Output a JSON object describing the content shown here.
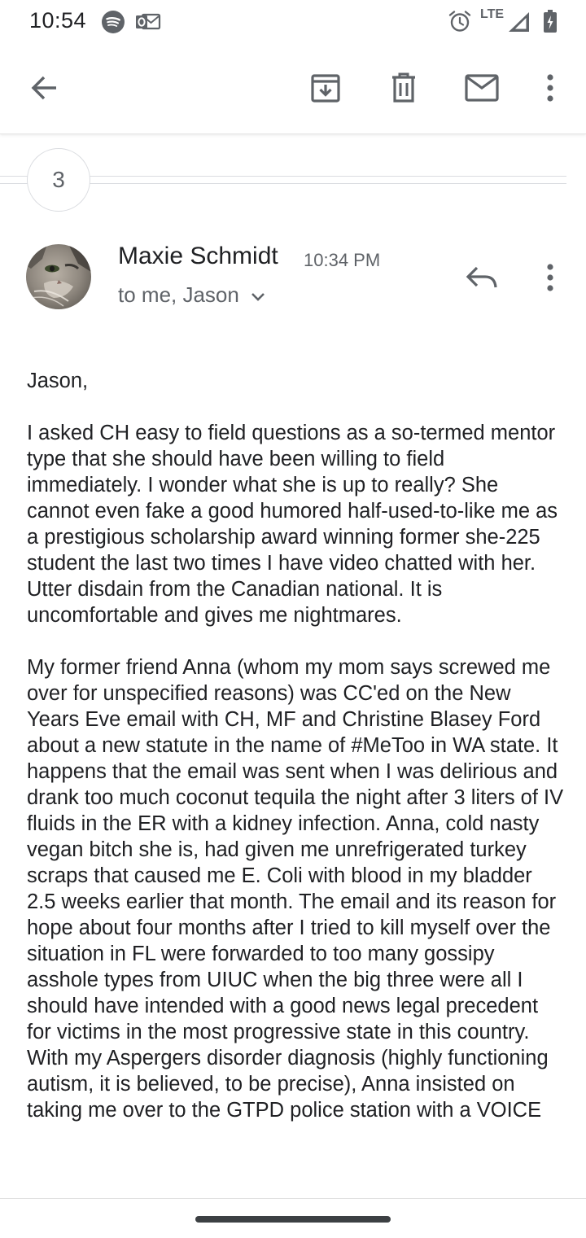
{
  "status_bar": {
    "time": "10:54",
    "network": "LTE",
    "icons": [
      "spotify-icon",
      "outlook-icon",
      "alarm-icon",
      "signal-icon",
      "battery-icon"
    ]
  },
  "app_bar": {
    "icons": [
      "back-arrow-icon",
      "archive-icon",
      "delete-icon",
      "mark-unread-icon",
      "more-vert-icon"
    ]
  },
  "thread": {
    "collapsed_count": "3"
  },
  "message": {
    "sender": "Maxie Schmidt",
    "time": "10:34 PM",
    "recipients": "to me, Jason",
    "body": [
      "Jason,",
      "I asked CH easy to field questions as a so-termed mentor type that she should have been willing to field immediately. I wonder what she is up to really? She cannot even fake a good humored half-used-to-like me as a prestigious scholarship award winning former she-225 student the last two times I have video chatted with her. Utter disdain from the Canadian national. It is uncomfortable and gives me nightmares.",
      "My former friend Anna (whom my mom says screwed me over for unspecified reasons) was CC'ed on the New Years Eve email with CH, MF and Christine Blasey Ford about a new statute in the name of #MeToo in WA state. It happens that the email was sent when I was delirious and drank too much coconut tequila the night after 3 liters of IV fluids in the ER with a kidney infection. Anna, cold nasty vegan bitch she is, had given me unrefrigerated turkey scraps that caused me E. Coli with blood in my bladder 2.5 weeks earlier that month. The email and its reason for hope about four months after I tried to kill myself over the situation in FL were forwarded to too many gossipy asshole types from UIUC when the big three were all I should have intended with a good news legal precedent for victims in the most progressive state in this country. With my Aspergers disorder diagnosis (highly functioning autism, it is believed, to be precise), Anna insisted on taking me over to the GTPD police station with a VOICE"
    ]
  },
  "colors": {
    "text_primary": "#202124",
    "text_secondary": "#5f6368",
    "divider": "#dadce0"
  }
}
